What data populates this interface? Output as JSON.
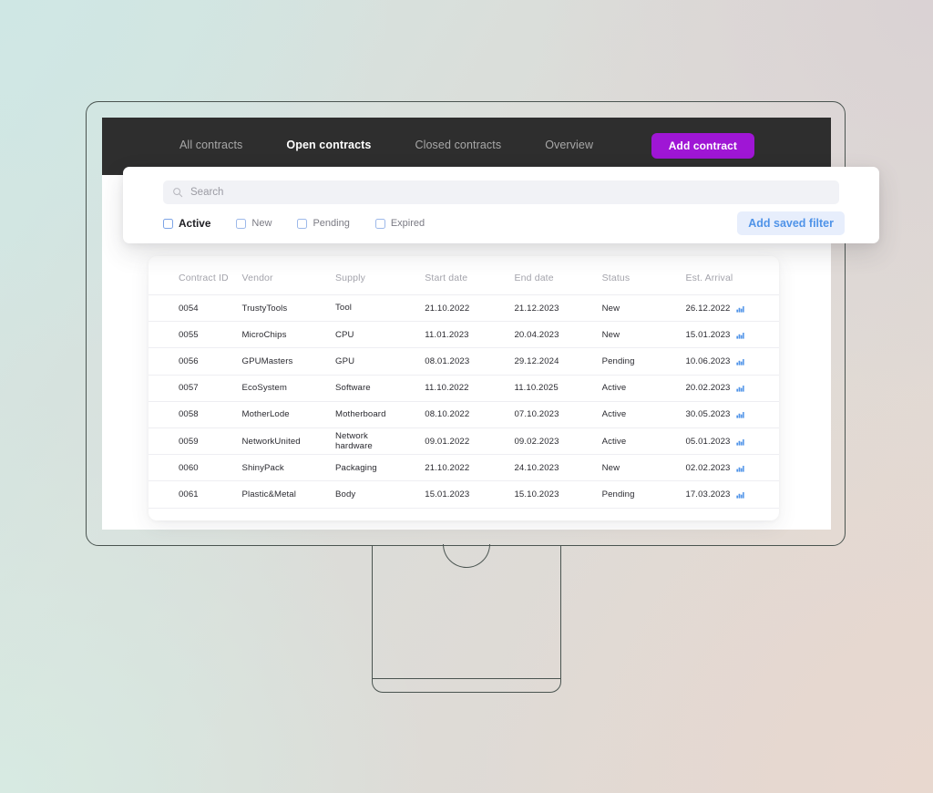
{
  "theme": {
    "accent_purple": "#9F16D5",
    "accent_blue": "#4F93E8",
    "status_new": "#B93FD4",
    "status_pending": "#E8A53C",
    "status_active": "#55C455",
    "navbar_bg": "#2E2E2E"
  },
  "navbar": {
    "tabs": [
      {
        "label": "All contracts",
        "active": false
      },
      {
        "label": "Open contracts",
        "active": true
      },
      {
        "label": "Closed contracts",
        "active": false
      },
      {
        "label": "Overview",
        "active": false
      }
    ],
    "primary_action": "Add contract"
  },
  "filter_panel": {
    "search": {
      "value": "",
      "placeholder": "Search",
      "icon": "search-icon"
    },
    "checkboxes": [
      {
        "label": "Active",
        "checked": false,
        "emphasis": true
      },
      {
        "label": "New",
        "checked": false,
        "emphasis": false
      },
      {
        "label": "Pending",
        "checked": false,
        "emphasis": false
      },
      {
        "label": "Expired",
        "checked": false,
        "emphasis": false
      }
    ],
    "saved_filter_button": "Add saved filter"
  },
  "table": {
    "columns": [
      "Contract ID",
      "Vendor",
      "Supply",
      "Start date",
      "End date",
      "Status",
      "Est. Arrival"
    ],
    "rows": [
      {
        "contract_id": "0054",
        "vendor": "TrustyTools",
        "supply": "Tool",
        "start_date": "21.10.2022",
        "end_date": "21.12.2023",
        "status": "New",
        "status_kind": "new",
        "est_arrival": "26.12.2022",
        "icon": "bar-chart-icon"
      },
      {
        "contract_id": "0055",
        "vendor": "MicroChips",
        "supply": "CPU",
        "start_date": "11.01.2023",
        "end_date": "20.04.2023",
        "status": "New",
        "status_kind": "new",
        "est_arrival": "15.01.2023",
        "icon": "bar-chart-icon"
      },
      {
        "contract_id": "0056",
        "vendor": "GPUMasters",
        "supply": "GPU",
        "start_date": "08.01.2023",
        "end_date": "29.12.2024",
        "status": "Pending",
        "status_kind": "pending",
        "est_arrival": "10.06.2023",
        "icon": "bar-chart-icon"
      },
      {
        "contract_id": "0057",
        "vendor": "EcoSystem",
        "supply": "Software",
        "start_date": "11.10.2022",
        "end_date": "11.10.2025",
        "status": "Active",
        "status_kind": "active",
        "est_arrival": "20.02.2023",
        "icon": "bar-chart-icon"
      },
      {
        "contract_id": "0058",
        "vendor": "MotherLode",
        "supply": "Motherboard",
        "start_date": "08.10.2022",
        "end_date": "07.10.2023",
        "status": "Active",
        "status_kind": "active",
        "est_arrival": "30.05.2023",
        "icon": "bar-chart-icon"
      },
      {
        "contract_id": "0059",
        "vendor": "NetworkUnited",
        "supply": "Network hardware",
        "start_date": "09.01.2022",
        "end_date": "09.02.2023",
        "status": "Active",
        "status_kind": "active",
        "est_arrival": "05.01.2023",
        "icon": "bar-chart-icon"
      },
      {
        "contract_id": "0060",
        "vendor": "ShinyPack",
        "supply": "Packaging",
        "start_date": "21.10.2022",
        "end_date": "24.10.2023",
        "status": "New",
        "status_kind": "new",
        "est_arrival": "02.02.2023",
        "icon": "bar-chart-icon"
      },
      {
        "contract_id": "0061",
        "vendor": "Plastic&Metal",
        "supply": "Body",
        "start_date": "15.01.2023",
        "end_date": "15.10.2023",
        "status": "Pending",
        "status_kind": "pending",
        "est_arrival": "17.03.2023",
        "icon": "bar-chart-icon"
      }
    ]
  }
}
